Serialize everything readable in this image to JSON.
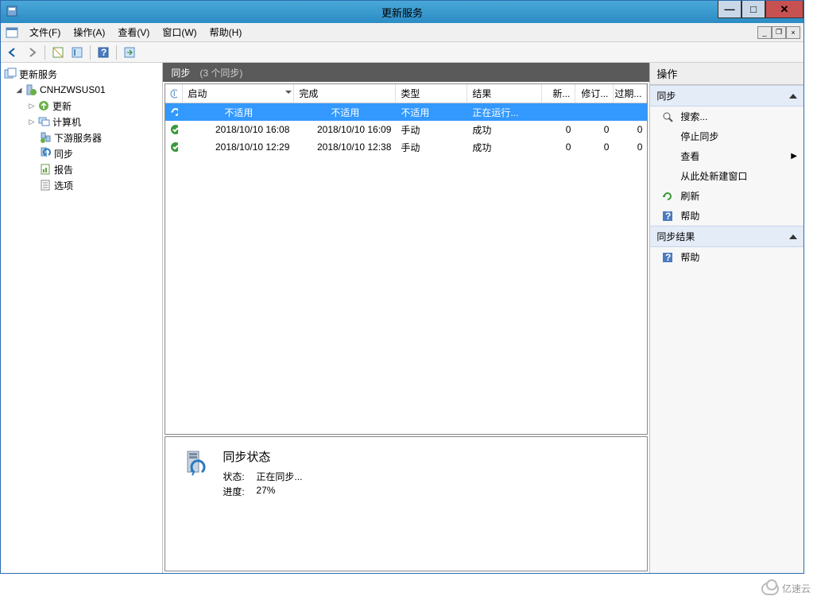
{
  "window": {
    "title": "更新服务"
  },
  "menubar": {
    "items": [
      {
        "label": "文件(F)"
      },
      {
        "label": "操作(A)"
      },
      {
        "label": "查看(V)"
      },
      {
        "label": "窗口(W)"
      },
      {
        "label": "帮助(H)"
      }
    ]
  },
  "tree": {
    "root": "更新服务",
    "server": "CNHZWSUS01",
    "nodes": [
      {
        "label": "更新"
      },
      {
        "label": "计算机"
      },
      {
        "label": "下游服务器"
      },
      {
        "label": "同步"
      },
      {
        "label": "报告"
      },
      {
        "label": "选项"
      }
    ]
  },
  "center": {
    "title": "同步",
    "count_label": "(3 个同步)",
    "columns": {
      "start": "启动",
      "end": "完成",
      "type": "类型",
      "result": "结果",
      "new": "新...",
      "rev": "修订...",
      "expired": "过期..."
    },
    "rows": [
      {
        "start": "不适用",
        "end": "不适用",
        "type": "不适用",
        "result": "正在运行...",
        "new": "",
        "rev": "",
        "expired": "",
        "selected": true
      },
      {
        "start": "2018/10/10 16:08",
        "end": "2018/10/10 16:09",
        "type": "手动",
        "result": "成功",
        "new": "0",
        "rev": "0",
        "expired": "0",
        "selected": false
      },
      {
        "start": "2018/10/10 12:29",
        "end": "2018/10/10 12:38",
        "type": "手动",
        "result": "成功",
        "new": "0",
        "rev": "0",
        "expired": "0",
        "selected": false
      }
    ],
    "detail": {
      "title": "同步状态",
      "status_label": "状态:",
      "status_value": "正在同步...",
      "progress_label": "进度:",
      "progress_value": "27%"
    }
  },
  "actions": {
    "title": "操作",
    "section1": "同步",
    "s1_items": {
      "search": "搜索...",
      "stop_sync": "停止同步",
      "view": "查看",
      "new_window": "从此处新建窗口",
      "refresh": "刷新",
      "help": "帮助"
    },
    "section2": "同步结果",
    "s2_items": {
      "help": "帮助"
    }
  },
  "watermark": "亿速云"
}
